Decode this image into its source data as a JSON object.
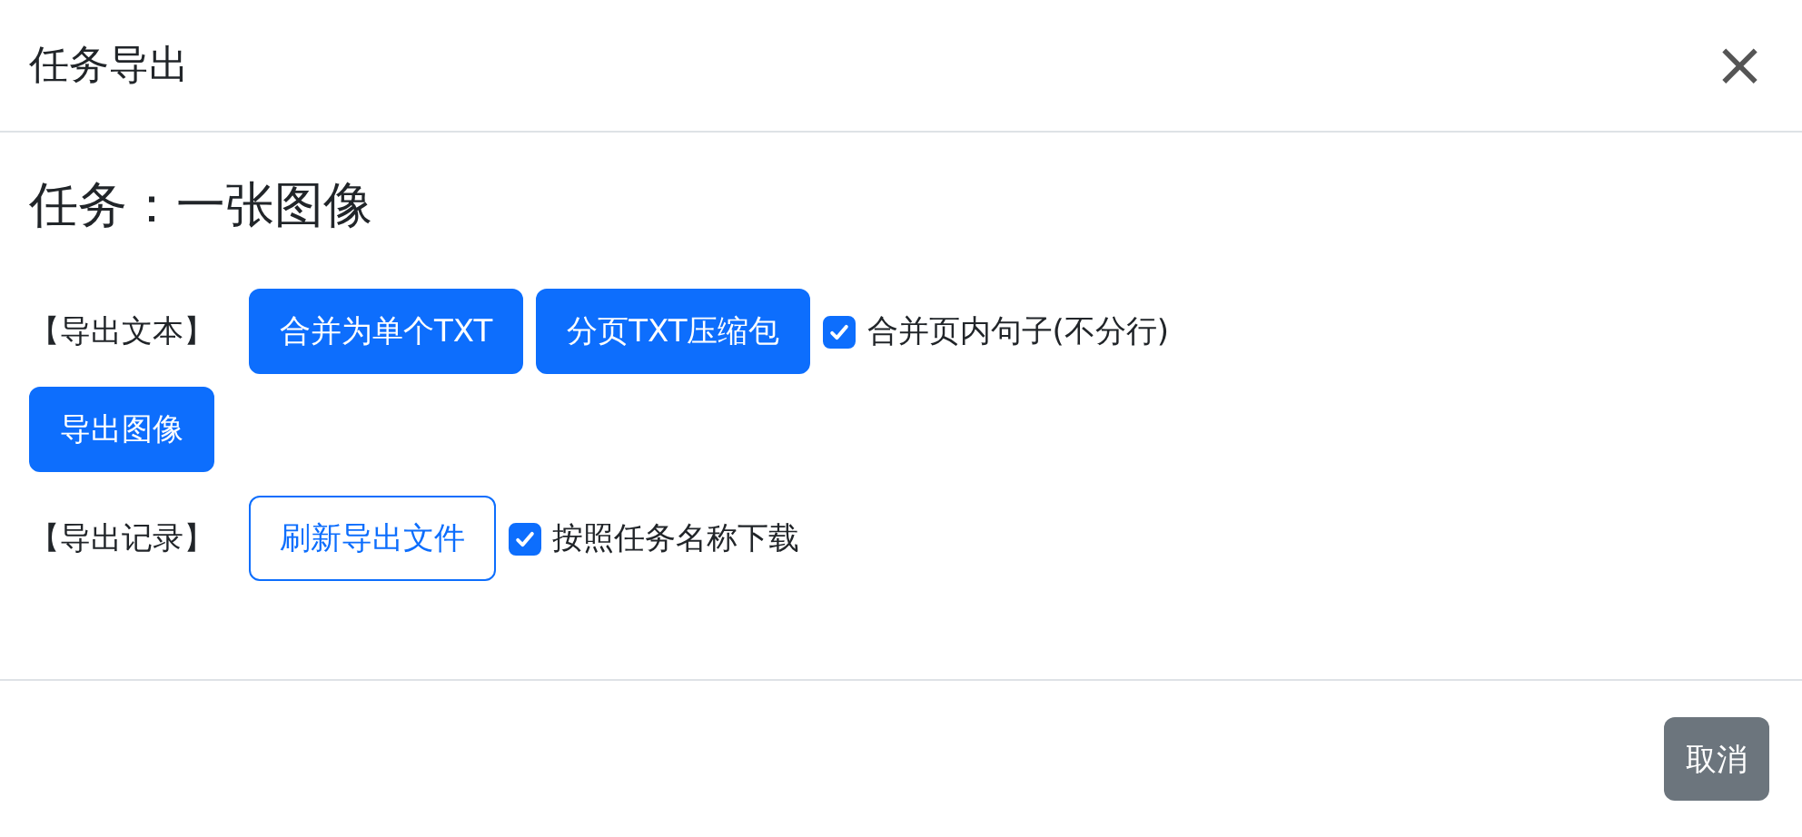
{
  "dialog": {
    "title": "任务导出",
    "close": "×"
  },
  "task_title": "任务：一张图像",
  "rows": [
    {
      "label": "【导出文本】",
      "items": [
        {
          "kind": "button",
          "text": "合并为单个TXT"
        },
        {
          "kind": "button",
          "text": "分页TXT压缩包"
        },
        {
          "kind": "checkbox",
          "text": "合并页内句子(不分行)",
          "checked": true
        }
      ]
    },
    {
      "items": [
        {
          "kind": "button",
          "text": "导出图像"
        }
      ]
    },
    {
      "label": "【导出记录】",
      "items": [
        {
          "kind": "outline",
          "text": "刷新导出文件"
        },
        {
          "kind": "checkbox",
          "text": "按照任务名称下载",
          "checked": true
        }
      ]
    }
  ],
  "footer": {
    "cancel": "取消"
  }
}
